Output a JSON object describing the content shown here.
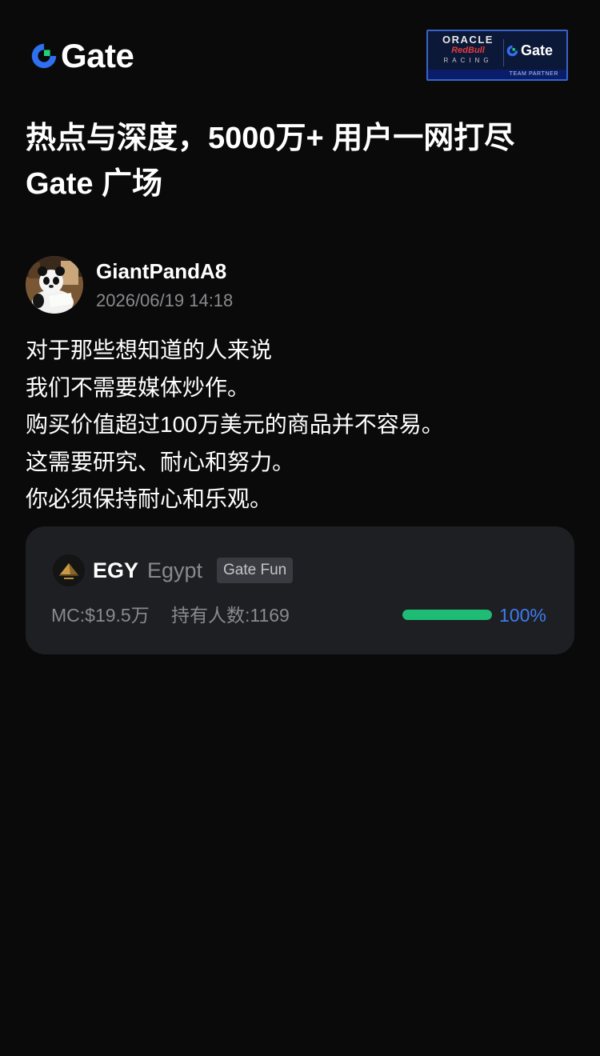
{
  "header": {
    "logo_text": "Gate",
    "partner": {
      "oracle": "ORACLE",
      "redbull": "RedBull",
      "racing": "RACING",
      "gate_text": "Gate",
      "footer": "TEAM PARTNER"
    }
  },
  "hero": {
    "title_line1": "热点与深度，5000万+ 用户一网打尽",
    "title_line2": "Gate 广场"
  },
  "post": {
    "author_name": "GiantPandA8",
    "timestamp": "2026/06/19 14:18",
    "lines": [
      "对于那些想知道的人来说",
      "我们不需要媒体炒作。",
      "购买价值超过100万美元的商品并不容易。",
      "这需要研究、耐心和努力。",
      "你必须保持耐心和乐观。"
    ]
  },
  "token": {
    "symbol": "EGY",
    "name": "Egypt",
    "tag": "Gate Fun",
    "market_cap": "MC:$19.5万",
    "holders": "持有人数:1169",
    "progress_label": "100%",
    "progress": 1.0
  },
  "colors": {
    "background": "#0a0a0b",
    "card": "#1e1f23",
    "brand_blue": "#3d7cf4",
    "progress_green": "#1ebc74",
    "muted_text": "#8a8a8e"
  },
  "icons": {
    "logo": "gate-logo-icon",
    "avatar": "panda-avatar",
    "token": "pyramid-token-icon"
  }
}
